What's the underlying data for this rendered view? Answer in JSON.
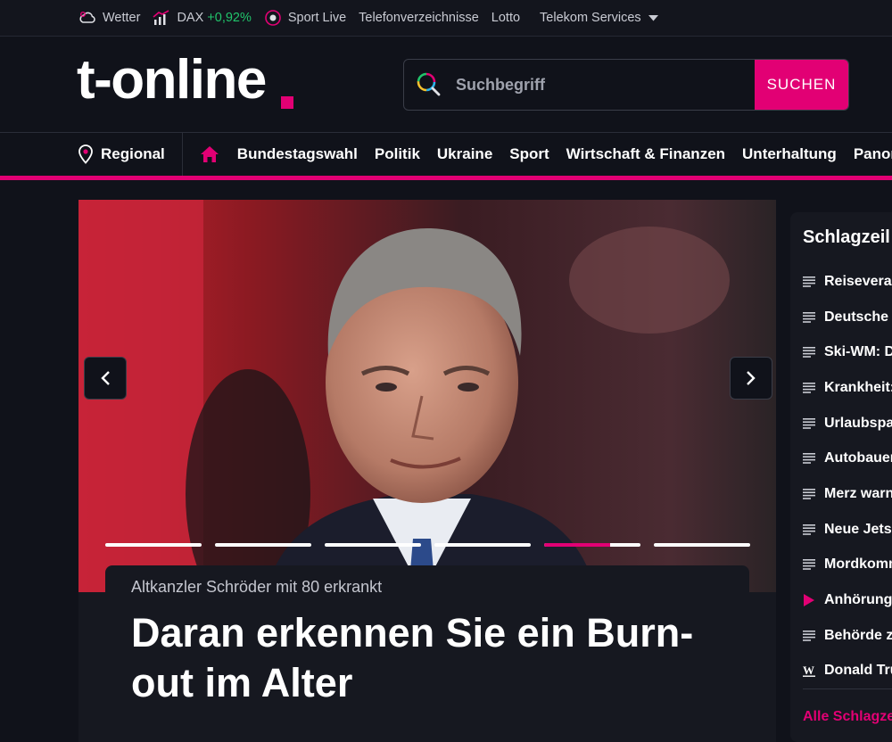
{
  "topbar": {
    "wetter": "Wetter",
    "dax_label": "DAX",
    "dax_value": "+0,92%",
    "sport_live": "Sport Live",
    "telefon": "Telefonverzeichnisse",
    "lotto": "Lotto",
    "telekom": "Telekom Services"
  },
  "header": {
    "logo": "t-online",
    "search_placeholder": "Suchbegriff",
    "search_button": "SUCHEN"
  },
  "nav": {
    "regional": "Regional",
    "items": [
      "Bundestagswahl",
      "Politik",
      "Ukraine",
      "Sport",
      "Wirtschaft & Finanzen",
      "Unterhaltung",
      "Panorama"
    ]
  },
  "hero": {
    "kicker": "Altkanzler Schröder mit 80 erkrankt",
    "headline": "Daran erkennen Sie ein Burn-out im Alter",
    "slides_total": 6,
    "active_slide": 5,
    "active_progress": 0.68
  },
  "panel": {
    "title": "Schlagzeil",
    "items": [
      {
        "icon": "list-icon",
        "text": "Reiseveran"
      },
      {
        "icon": "list-icon",
        "text": "Deutsche"
      },
      {
        "icon": "list-icon",
        "text": "Ski-WM: D"
      },
      {
        "icon": "list-icon",
        "text": "Krankheit:"
      },
      {
        "icon": "list-icon",
        "text": "Urlaubspa"
      },
      {
        "icon": "list-icon",
        "text": "Autobauer"
      },
      {
        "icon": "list-icon",
        "text": "Merz warn"
      },
      {
        "icon": "list-icon",
        "text": "Neue Jets"
      },
      {
        "icon": "list-icon",
        "text": "Mordkomm"
      },
      {
        "icon": "play-icon",
        "text": "Anhörung"
      },
      {
        "icon": "list-icon",
        "text": "Behörde z"
      },
      {
        "icon": "w-icon",
        "text": "Donald Tru"
      }
    ],
    "all_link": "Alle Schlagze"
  },
  "colors": {
    "brand": "#e20074",
    "background": "#10121a",
    "positive": "#21c46b"
  }
}
